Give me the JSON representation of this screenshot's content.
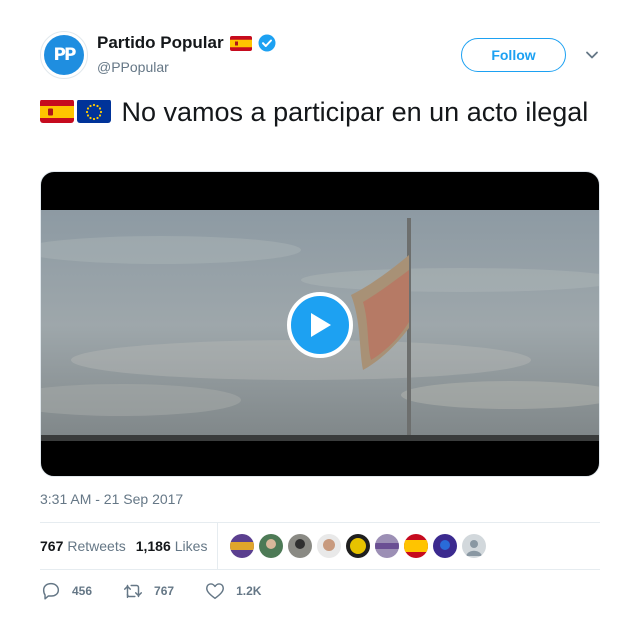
{
  "account": {
    "display_name": "Partido Popular",
    "handle": "@PPopular",
    "avatar_text": "PP",
    "verified": true
  },
  "header": {
    "follow_label": "Follow"
  },
  "tweet": {
    "text": "No vamos a participar en un acto ilegal",
    "timestamp": "3:31 AM - 21 Sep 2017"
  },
  "stats": {
    "retweets_count": "767",
    "retweets_label": "Retweets",
    "likes_count": "1,186",
    "likes_label": "Likes"
  },
  "actions": {
    "replies": "456",
    "retweets": "767",
    "likes": "1.2K"
  },
  "colors": {
    "accent": "#1da1f2",
    "text": "#14171a",
    "muted": "#657786"
  },
  "icons": [
    "spain-flag-icon",
    "eu-flag-icon",
    "verified-icon",
    "chevron-down-icon",
    "play-icon",
    "reply-icon",
    "retweet-icon",
    "like-icon"
  ]
}
